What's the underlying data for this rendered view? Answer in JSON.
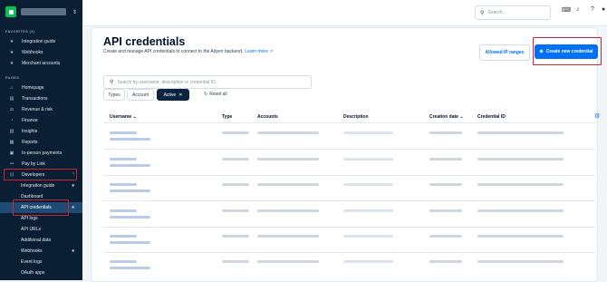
{
  "sidebar": {
    "sections": [
      {
        "title": "FAVORITES (3)"
      },
      {
        "title": "PAGES"
      }
    ],
    "favorites": [
      {
        "label": "Integration guide",
        "icon": "star"
      },
      {
        "label": "Webhooks",
        "icon": "star"
      },
      {
        "label": "Merchant accounts",
        "icon": "star"
      }
    ],
    "pages": [
      {
        "label": "Homepage",
        "icon": "home"
      },
      {
        "label": "Transactions",
        "icon": "receipt"
      },
      {
        "label": "Revenue & risk",
        "icon": "revenue"
      },
      {
        "label": "Finance",
        "icon": "finance"
      },
      {
        "label": "Insights",
        "icon": "chart"
      },
      {
        "label": "Reports",
        "icon": "report"
      },
      {
        "label": "In-person payments",
        "icon": "terminal"
      },
      {
        "label": "Pay by Link",
        "icon": "link"
      },
      {
        "label": "Developers",
        "icon": "code"
      }
    ],
    "developer_items": [
      {
        "label": "Integration guide",
        "starred": true
      },
      {
        "label": "Dashboard",
        "starred": false
      },
      {
        "label": "API credentials",
        "starred": true
      },
      {
        "label": "API logs",
        "starred": false
      },
      {
        "label": "API URLs",
        "starred": false
      },
      {
        "label": "Additional data",
        "starred": false
      },
      {
        "label": "Webhooks",
        "starred": true
      },
      {
        "label": "Event logs",
        "starred": false
      },
      {
        "label": "OAuth apps",
        "starred": false
      }
    ]
  },
  "topbar": {
    "search_placeholder": "Search..."
  },
  "page": {
    "title": "API credentials",
    "description": "Create and manage API credentials to connect to the Adyen backend.",
    "learn_more": "Learn more ↗",
    "allowed_ip_button": "Allowed IP ranges",
    "create_button": "Create new credential"
  },
  "filters": {
    "search_placeholder": "Search by username, description or credential ID...",
    "type_chip": "Types",
    "account_chip": "Account",
    "active_chip": "Active",
    "reset": "Reset all"
  },
  "table": {
    "columns": [
      "Username ⌄",
      "Type",
      "Accounts",
      "Description",
      "Creation date ⌄",
      "Credential ID"
    ]
  },
  "colors": {
    "accent": "#0070f5",
    "sidebar_bg": "#0a1f33",
    "highlight": "#d0232f",
    "logo": "#0abf53"
  }
}
